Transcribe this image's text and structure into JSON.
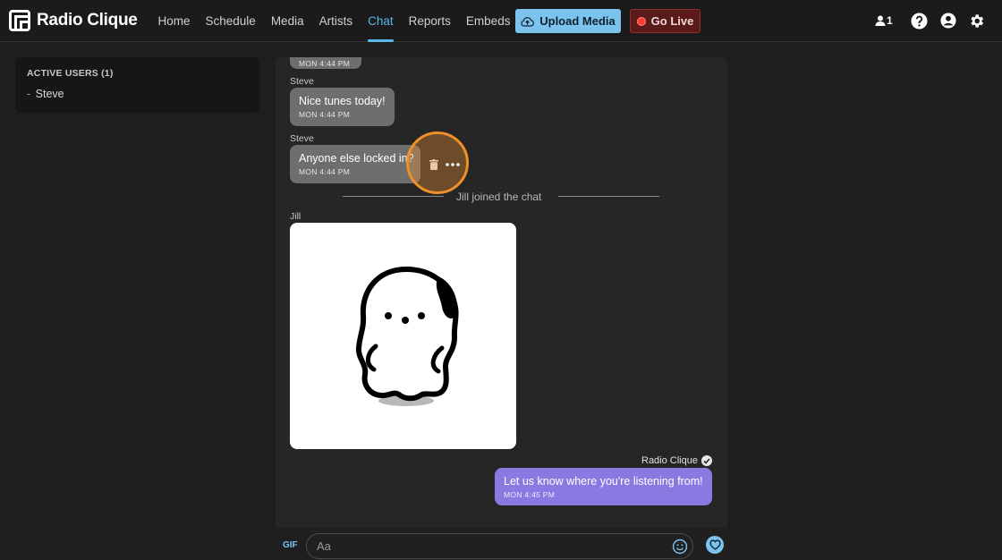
{
  "brand": {
    "name": "Radio Clique"
  },
  "nav": {
    "items": [
      {
        "label": "Home",
        "active": false
      },
      {
        "label": "Schedule",
        "active": false
      },
      {
        "label": "Media",
        "active": false
      },
      {
        "label": "Artists",
        "active": false
      },
      {
        "label": "Chat",
        "active": true
      },
      {
        "label": "Reports",
        "active": false
      },
      {
        "label": "Embeds",
        "active": false
      }
    ]
  },
  "actions": {
    "upload_label": "Upload Media",
    "live_label": "Go Live"
  },
  "top_icons": {
    "listener_count": "1",
    "icons": [
      "listener-icon",
      "help-icon",
      "account-icon",
      "settings-icon"
    ]
  },
  "sidebar": {
    "title": "ACTIVE USERS (1)",
    "users": [
      "Steve"
    ]
  },
  "chat": {
    "messages": [
      {
        "sender": "",
        "text": "",
        "time": "MON 4:44 PM"
      },
      {
        "sender": "Steve",
        "text": "Nice tunes today!",
        "time": "MON 4:44 PM"
      },
      {
        "sender": "Steve",
        "text": "Anyone else locked in?",
        "time": "MON 4:44 PM"
      }
    ],
    "system_event": "Jill joined the chat",
    "image_message": {
      "sender": "Jill"
    },
    "own_message": {
      "sender": "Radio Clique",
      "text": "Let us know where you're listening from!",
      "time": "MON 4:45 PM"
    }
  },
  "composer": {
    "gif_label": "GIF",
    "placeholder": "Aa"
  },
  "colors": {
    "accent": "#5ab8ea",
    "own_bubble": "#8b78e0",
    "bubble": "#6e6e6e",
    "live": "#ff3b30",
    "highlight": "#f0902a"
  }
}
